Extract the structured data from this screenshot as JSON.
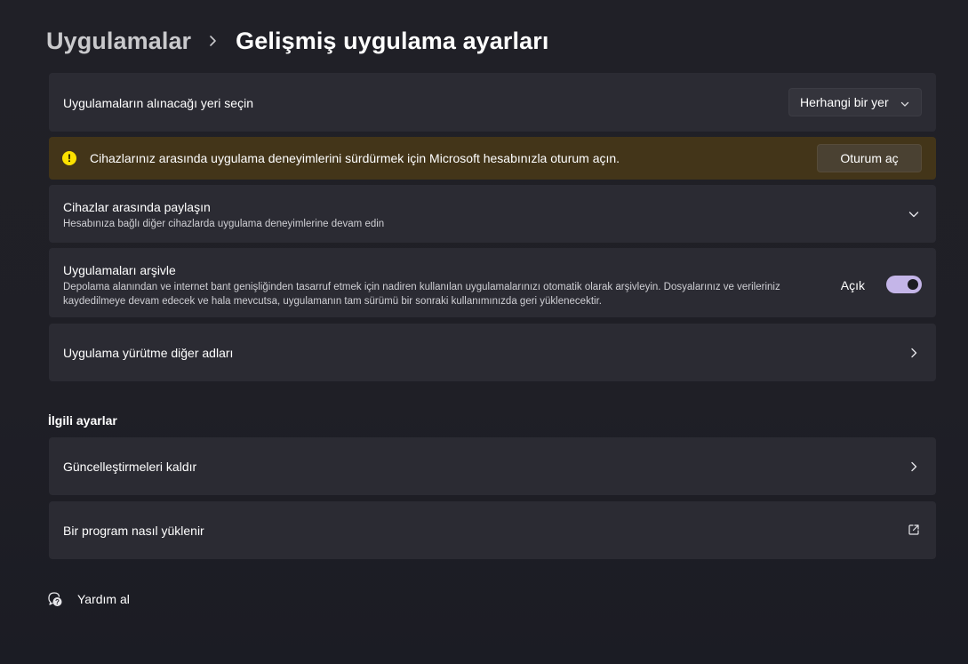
{
  "breadcrumb": {
    "parent": "Uygulamalar",
    "current": "Gelişmiş uygulama ayarları"
  },
  "app_source": {
    "title": "Uygulamaların alınacağı yeri seçin",
    "selected": "Herhangi bir yer"
  },
  "banner": {
    "icon": "!",
    "text": "Cihazlarınız arasında uygulama deneyimlerini sürdürmek için Microsoft hesabınızla oturum açın.",
    "button": "Oturum aç"
  },
  "share": {
    "title": "Cihazlar arasında paylaşın",
    "subtitle": "Hesabınıza bağlı diğer cihazlarda uygulama deneyimlerine devam edin"
  },
  "archive": {
    "title": "Uygulamaları arşivle",
    "subtitle": "Depolama alanından ve internet bant genişliğinden tasarruf etmek için nadiren kullanılan uygulamalarınızı otomatik olarak arşivleyin. Dosyalarınız ve verileriniz kaydedilmeye devam edecek ve hala mevcutsa, uygulamanın tam sürümü bir sonraki kullanımınızda geri yüklenecektir.",
    "toggle_label": "Açık",
    "toggle_on": true
  },
  "aliases": {
    "title": "Uygulama yürütme diğer adları"
  },
  "related": {
    "heading": "İlgili ayarlar",
    "items": [
      {
        "label": "Güncelleştirmeleri kaldır"
      },
      {
        "label": "Bir program nasıl yüklenir"
      }
    ]
  },
  "help": {
    "label": "Yardım al"
  },
  "colors": {
    "accent": "#c4b5e8",
    "warning": "#fce100",
    "banner_bg": "#433519",
    "card_bg": "#2b2b33"
  }
}
